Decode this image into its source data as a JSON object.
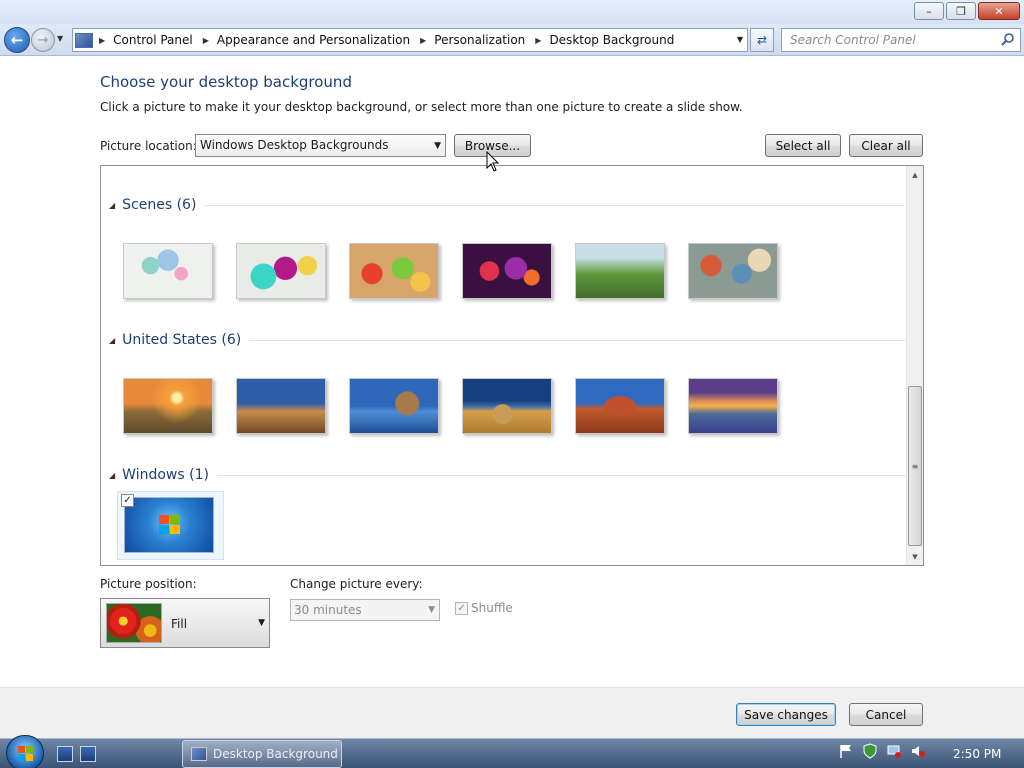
{
  "window": {
    "controls": {
      "minimize": "–",
      "maximize": "❐",
      "close": "✕"
    }
  },
  "nav": {
    "back_icon": "back-arrow-icon",
    "forward_icon": "forward-arrow-icon",
    "breadcrumb": [
      "Control Panel",
      "Appearance and Personalization",
      "Personalization",
      "Desktop Background"
    ],
    "search_placeholder": "Search Control Panel"
  },
  "page": {
    "title": "Choose your desktop background",
    "subtitle": "Click a picture to make it your desktop background, or select more than one picture to create a slide show.",
    "picture_location_label": "Picture location:",
    "picture_location_value": "Windows Desktop Backgrounds",
    "browse_label": "Browse...",
    "select_all_label": "Select all",
    "clear_all_label": "Clear all"
  },
  "groups": [
    {
      "label": "Scenes (6)",
      "thumbs": [
        "scene-1",
        "scene-2",
        "scene-3",
        "scene-4",
        "scene-5",
        "scene-6"
      ]
    },
    {
      "label": "United States (6)",
      "thumbs": [
        "us-1",
        "us-2",
        "us-3",
        "us-4",
        "us-5",
        "us-6"
      ]
    },
    {
      "label": "Windows (1)",
      "thumbs": [
        "windows-1"
      ],
      "selected": true
    }
  ],
  "bottom": {
    "picture_position_label": "Picture position:",
    "picture_position_value": "Fill",
    "change_every_label": "Change picture every:",
    "change_every_value": "30 minutes",
    "shuffle_label": "Shuffle",
    "shuffle_checked": true
  },
  "footer": {
    "save_label": "Save changes",
    "cancel_label": "Cancel"
  },
  "taskbar": {
    "task_label": "Desktop Background",
    "clock": "2:50 PM"
  },
  "colors": {
    "heading": "#1e3f74",
    "accent": "#3c7fb1"
  }
}
